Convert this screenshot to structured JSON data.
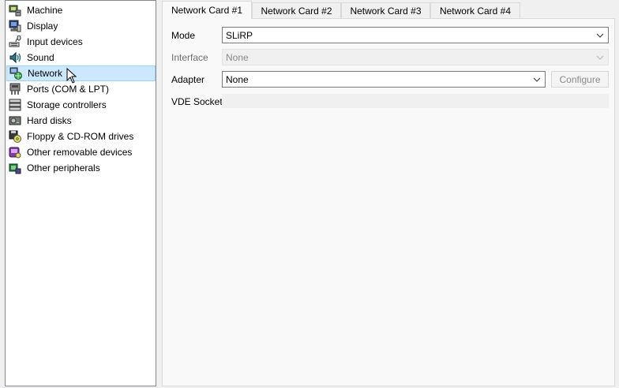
{
  "sidebar": {
    "items": [
      {
        "label": "Machine",
        "icon": "machine-icon"
      },
      {
        "label": "Display",
        "icon": "display-icon"
      },
      {
        "label": "Input devices",
        "icon": "input-devices-icon"
      },
      {
        "label": "Sound",
        "icon": "sound-icon"
      },
      {
        "label": "Network",
        "icon": "network-icon",
        "selected": true
      },
      {
        "label": "Ports (COM & LPT)",
        "icon": "ports-icon"
      },
      {
        "label": "Storage controllers",
        "icon": "storage-controllers-icon"
      },
      {
        "label": "Hard disks",
        "icon": "hard-disks-icon"
      },
      {
        "label": "Floppy & CD-ROM drives",
        "icon": "floppy-cdrom-icon"
      },
      {
        "label": "Other removable devices",
        "icon": "removable-devices-icon"
      },
      {
        "label": "Other peripherals",
        "icon": "peripherals-icon"
      }
    ]
  },
  "tabs": [
    {
      "label": "Network Card #1",
      "active": true
    },
    {
      "label": "Network Card #2"
    },
    {
      "label": "Network Card #3"
    },
    {
      "label": "Network Card #4"
    }
  ],
  "form": {
    "mode_label": "Mode",
    "mode_value": "SLiRP",
    "interface_label": "Interface",
    "interface_value": "None",
    "adapter_label": "Adapter",
    "adapter_value": "None",
    "configure_label": "Configure",
    "vde_label": "VDE Socket",
    "vde_value": ""
  },
  "colors": {
    "selection_bg": "#cce8ff",
    "selection_border": "#99d1ff"
  }
}
